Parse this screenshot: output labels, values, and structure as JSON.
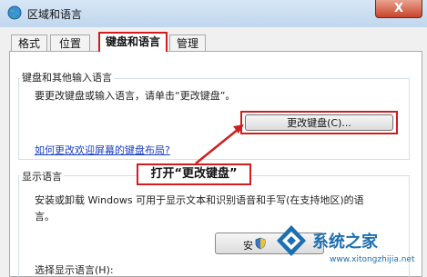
{
  "window": {
    "title": "区域和语言",
    "close_label": "X"
  },
  "tabs": [
    {
      "label": "格式"
    },
    {
      "label": "位置"
    },
    {
      "label": "键盘和语言"
    },
    {
      "label": "管理"
    }
  ],
  "keyboard_group": {
    "label": "键盘和其他输入语言",
    "description": "要更改键盘或输入语言，请单击“更改键盘”。",
    "change_button": "更改键盘(C)...",
    "link": "如何更改欢迎屏幕的键盘布局?"
  },
  "callout": {
    "text": "打开“更改键盘”"
  },
  "display_group": {
    "label": "显示语言",
    "description_line1": "安装或卸载 Windows 可用于显示文本和识别语音和手写(在支持地区)的语",
    "description_line2": "言。",
    "install_button": "安",
    "select_label": "选择显示语言(H):"
  },
  "watermark": {
    "brand": "系统之家",
    "url": "www.xitongzhijia.net"
  },
  "colors": {
    "highlight": "#d01e1e",
    "link": "#1a3fbf"
  }
}
